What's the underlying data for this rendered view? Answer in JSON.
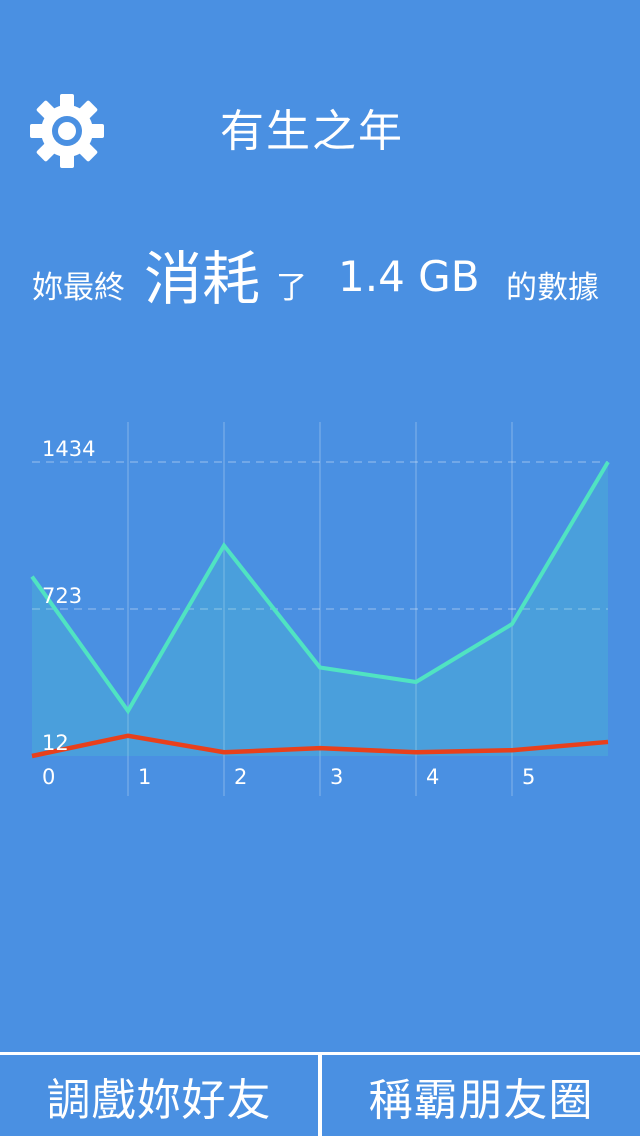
{
  "header": {
    "title": "有生之年",
    "settings_icon": "gear-icon"
  },
  "summary": {
    "prefix": "妳最終",
    "verb": "消耗",
    "particle": "了",
    "amount": "1.4 GB",
    "suffix": "的數據"
  },
  "colors": {
    "background": "#4a90e2",
    "primary_line": "#50e3c2",
    "secondary_line": "#e8401c",
    "text": "#ffffff"
  },
  "chart_data": {
    "type": "line",
    "x": [
      0,
      1,
      2,
      3,
      4,
      5,
      6
    ],
    "x_tick_labels": [
      "0",
      "1",
      "2",
      "3",
      "4",
      "5"
    ],
    "y_tick_labels": [
      "1434",
      "723",
      "12"
    ],
    "y_ticks": [
      1434,
      723,
      12
    ],
    "ylim": [
      12,
      1434
    ],
    "grid": true,
    "series": [
      {
        "values": [
          880,
          230,
          1030,
          440,
          370,
          650,
          1434
        ],
        "color": "#50e3c2",
        "filled": true
      },
      {
        "values": [
          12,
          110,
          30,
          50,
          30,
          40,
          80
        ],
        "color": "#e8401c",
        "filled": false
      }
    ]
  },
  "footer": {
    "left_button": "調戲妳好友",
    "right_button": "稱霸朋友圈"
  }
}
